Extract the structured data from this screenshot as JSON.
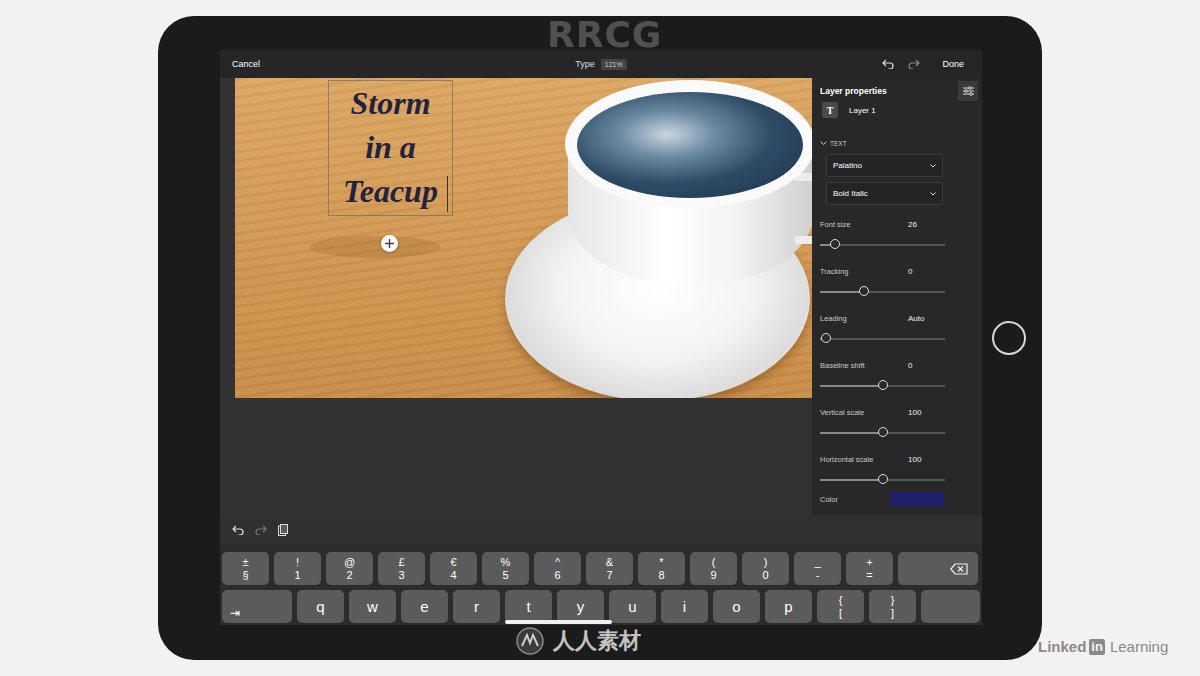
{
  "topbar": {
    "cancel": "Cancel",
    "tool": "Type",
    "zoom": "121%",
    "done": "Done"
  },
  "canvas": {
    "text_lines": [
      "Storm",
      "in a",
      "Teacup"
    ]
  },
  "panel": {
    "title": "Layer properties",
    "layer": {
      "icon": "T",
      "name": "Layer 1"
    },
    "section": "TEXT",
    "font": "Palatino",
    "style": "Bold Italic",
    "properties": [
      {
        "label": "Font size",
        "value": "26",
        "level": 0.12
      },
      {
        "label": "Tracking",
        "value": "0",
        "level": 0.35
      },
      {
        "label": "Leading",
        "value": "Auto",
        "level": 0.05
      },
      {
        "label": "Baseline shift",
        "value": "0",
        "level": 0.5
      },
      {
        "label": "Vertical scale",
        "value": "100",
        "level": 0.5
      },
      {
        "label": "Horizontal scale",
        "value": "100",
        "level": 0.5
      }
    ],
    "color_label": "Color",
    "color": "#1f1f6b"
  },
  "keyboard": {
    "rows": [
      [
        {
          "kind": "symbol",
          "top": "±",
          "bottom": "§"
        },
        {
          "kind": "symbol",
          "top": "!",
          "bottom": "1"
        },
        {
          "kind": "symbol",
          "top": "@",
          "bottom": "2"
        },
        {
          "kind": "symbol",
          "top": "£",
          "bottom": "3"
        },
        {
          "kind": "symbol",
          "top": "€",
          "bottom": "4"
        },
        {
          "kind": "symbol",
          "top": "%",
          "bottom": "5"
        },
        {
          "kind": "symbol",
          "top": "^",
          "bottom": "6"
        },
        {
          "kind": "symbol",
          "top": "&",
          "bottom": "7"
        },
        {
          "kind": "symbol",
          "top": "*",
          "bottom": "8"
        },
        {
          "kind": "symbol",
          "top": "(",
          "bottom": "9"
        },
        {
          "kind": "symbol",
          "top": ")",
          "bottom": "0"
        },
        {
          "kind": "symbol",
          "top": "_",
          "bottom": "-"
        },
        {
          "kind": "symbol",
          "top": "+",
          "bottom": "="
        },
        {
          "kind": "delete"
        }
      ],
      [
        {
          "kind": "tab",
          "label": "⇥"
        },
        {
          "kind": "letter",
          "label": "q"
        },
        {
          "kind": "letter",
          "label": "w"
        },
        {
          "kind": "letter",
          "label": "e"
        },
        {
          "kind": "letter",
          "label": "r"
        },
        {
          "kind": "letter",
          "label": "t"
        },
        {
          "kind": "letter",
          "label": "y"
        },
        {
          "kind": "letter",
          "label": "u"
        },
        {
          "kind": "letter",
          "label": "i"
        },
        {
          "kind": "letter",
          "label": "o"
        },
        {
          "kind": "letter",
          "label": "p"
        },
        {
          "kind": "symbol",
          "top": "{",
          "bottom": "["
        },
        {
          "kind": "symbol",
          "top": "}",
          "bottom": "]"
        },
        {
          "kind": "blank"
        }
      ]
    ]
  },
  "watermarks": {
    "top": "RRCG",
    "logo": "人人素材",
    "credit_brand": "Linked",
    "credit_in": "in",
    "credit_suffix": "Learning"
  }
}
